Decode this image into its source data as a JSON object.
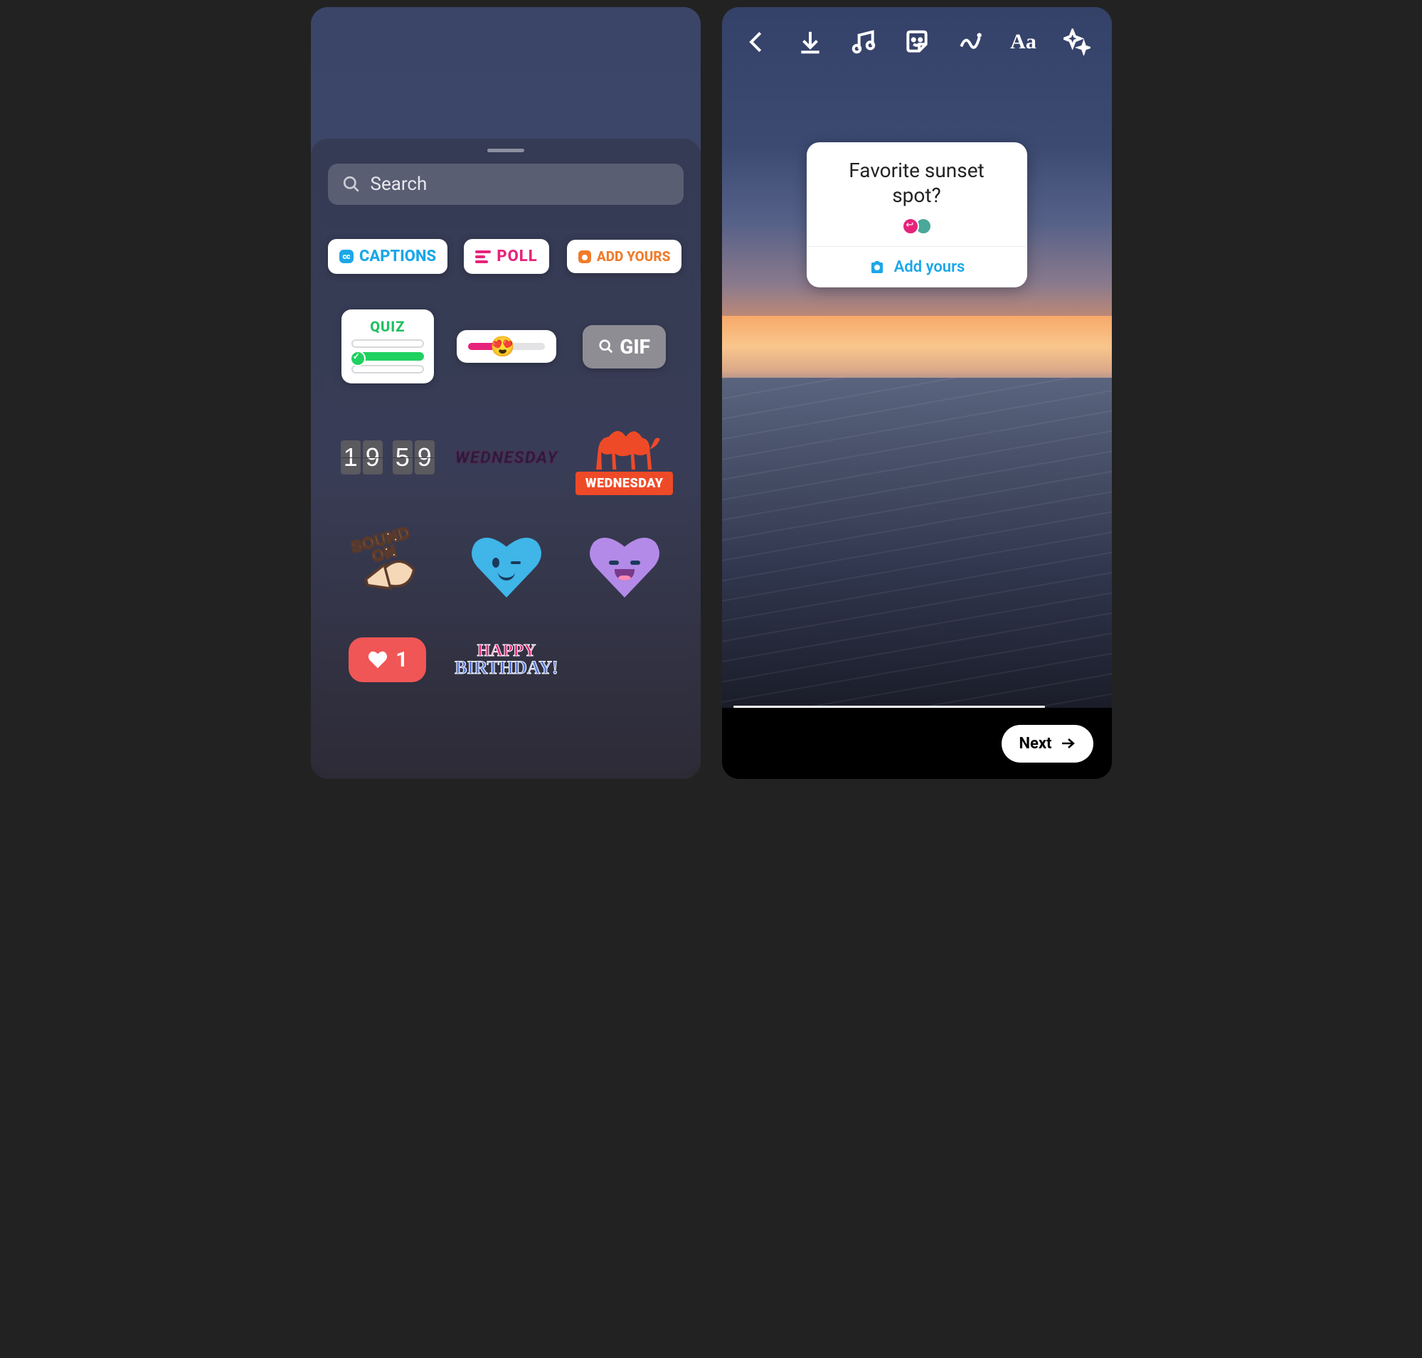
{
  "left": {
    "search_placeholder": "Search",
    "stickers": {
      "captions": "CAPTIONS",
      "cc": "cc",
      "poll": "POLL",
      "add_yours": "ADD YOURS",
      "quiz": "QUIZ",
      "gif": "GIF",
      "clock_digits": [
        "1",
        "9",
        "5",
        "9"
      ],
      "wednesday": "WEDNESDAY",
      "camel_label": "WEDNESDAY",
      "sound_on_l1": "SOUND",
      "sound_on_l2": "ON",
      "like_count": "1",
      "happy": "HAPPY",
      "birthday": "BIRTHDAY!"
    }
  },
  "right": {
    "prompt_question": "Favorite sunset spot?",
    "add_yours_action": "Add yours",
    "next_button": "Next",
    "text_tool": "Aa"
  }
}
